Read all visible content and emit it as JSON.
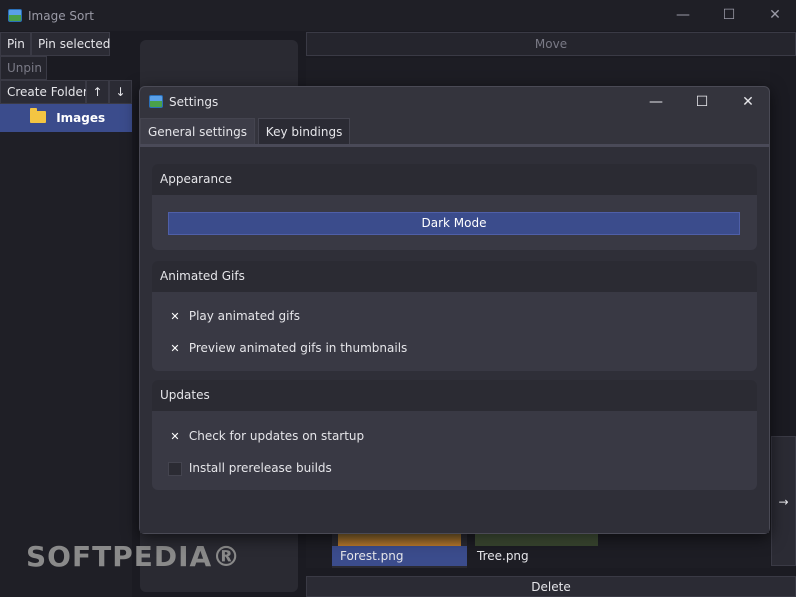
{
  "main": {
    "title": "Image Sort",
    "toolbar": {
      "pin": "Pin",
      "pin_selected": "Pin selected",
      "unpin": "Unpin",
      "create_folder": "Create Folder",
      "up": "↑",
      "down": "↓",
      "move": "Move",
      "delete": "Delete",
      "next": "→"
    },
    "folders": [
      {
        "label": "Images"
      }
    ],
    "thumbnails": [
      {
        "label": "Forest.png"
      },
      {
        "label": "Tree.png"
      }
    ],
    "window_controls": {
      "minimize": "—",
      "maximize": "☐",
      "close": "✕"
    }
  },
  "settings": {
    "title": "Settings",
    "window_controls": {
      "minimize": "—",
      "maximize": "☐",
      "close": "✕"
    },
    "tabs": [
      {
        "label": "General settings",
        "active": true
      },
      {
        "label": "Key bindings",
        "active": false
      }
    ],
    "appearance": {
      "header": "Appearance",
      "dark_mode_button": "Dark Mode"
    },
    "animated_gifs": {
      "header": "Animated Gifs",
      "options": [
        {
          "label": "Play animated gifs",
          "checked": true
        },
        {
          "label": "Preview animated gifs in thumbnails",
          "checked": true
        }
      ]
    },
    "updates": {
      "header": "Updates",
      "options": [
        {
          "label": "Check for updates on startup",
          "checked": true
        },
        {
          "label": "Install prerelease builds",
          "checked": false
        }
      ]
    }
  },
  "watermark": "SOFTPEDIA®",
  "colors": {
    "accent": "#3b4c8c",
    "background": "#1b1b22",
    "dialog": "#34343d"
  }
}
